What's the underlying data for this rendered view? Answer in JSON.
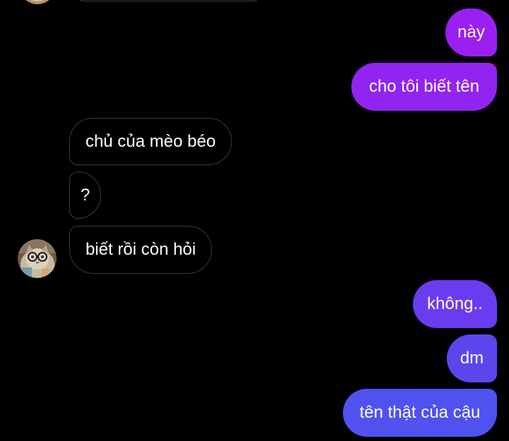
{
  "theme": {
    "background": "#000000",
    "incoming_bubble_bg": "#000000",
    "incoming_bubble_border": "#3a3a3a",
    "outgoing_gradient_top": "#9c1ff0",
    "outgoing_gradient_bottom": "#4d56ee",
    "text": "#ffffff"
  },
  "contact": {
    "avatar_icon": "cat-with-glasses-avatar-icon"
  },
  "messages": [
    {
      "id": "m1",
      "from": "me",
      "text": "này"
    },
    {
      "id": "m2",
      "from": "me",
      "text": "cho tôi biết tên"
    },
    {
      "id": "m3",
      "from": "them",
      "text": "chủ của mèo béo"
    },
    {
      "id": "m4",
      "from": "them",
      "text": "?"
    },
    {
      "id": "m5",
      "from": "them",
      "text": "biết rồi còn hỏi"
    },
    {
      "id": "m6",
      "from": "me",
      "text": "không.."
    },
    {
      "id": "m7",
      "from": "me",
      "text": "dm"
    },
    {
      "id": "m8",
      "from": "me",
      "text": "tên thật của cậu"
    }
  ]
}
